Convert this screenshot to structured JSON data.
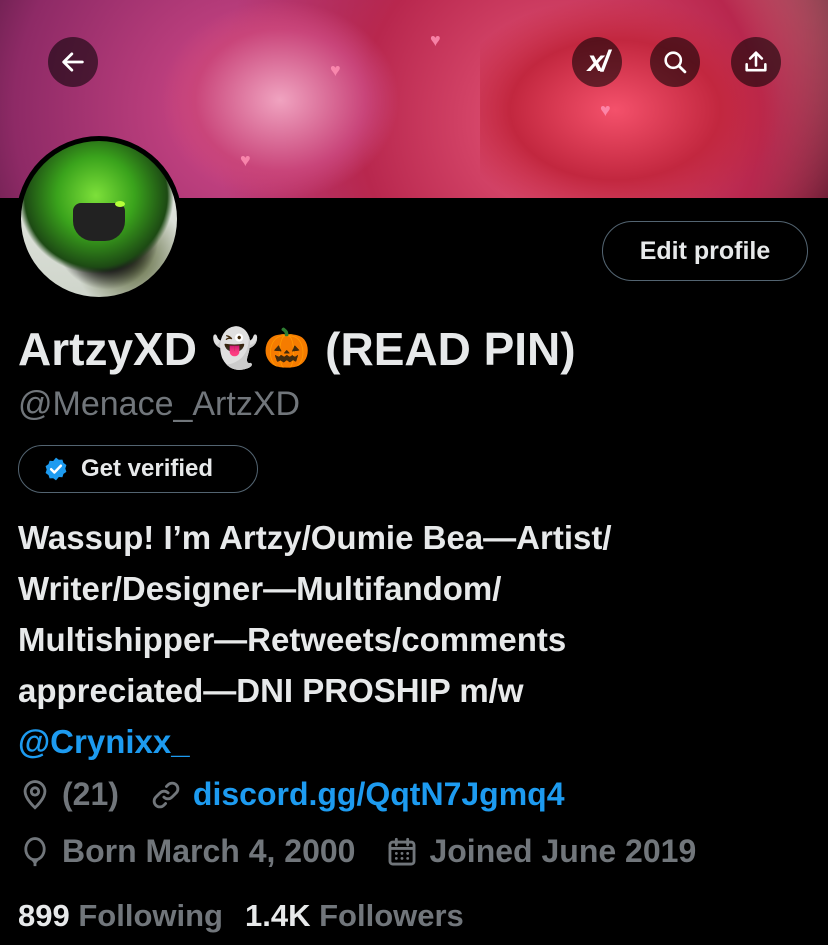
{
  "header": {
    "back_icon": "arrow-left-icon",
    "grok_icon": "xai-grok-icon",
    "grok_label": "x",
    "search_icon": "search-icon",
    "share_icon": "share-upload-icon"
  },
  "profile": {
    "display_name": "ArtzyXD",
    "name_emoji_1": "👻",
    "name_emoji_2": "🎃",
    "name_suffix": "(READ PIN)",
    "handle": "@Menace_ArtzXD",
    "edit_profile_label": "Edit profile",
    "get_verified_label": "Get verified"
  },
  "bio": {
    "line1": "Wassup! I’m Artzy/Oumie Bea—Artist/",
    "line2": "Writer/Designer—Multifandom/",
    "line3": "Multishipper—Retweets/comments",
    "line4": "appreciated—DNI PROSHIP m/w",
    "mention": "@Crynixx_"
  },
  "meta": {
    "location": "(21)",
    "website": "discord.gg/QqtN7Jgmq4",
    "birthday": "Born March 4, 2000",
    "joined": "Joined June 2019"
  },
  "stats": {
    "following_count": "899",
    "following_label": "Following",
    "followers_count": "1.4K",
    "followers_label": "Followers"
  },
  "colors": {
    "background": "#000000",
    "text_primary": "#e7e9ea",
    "text_secondary": "#71767b",
    "accent": "#1d9bf0",
    "border": "#536471"
  }
}
